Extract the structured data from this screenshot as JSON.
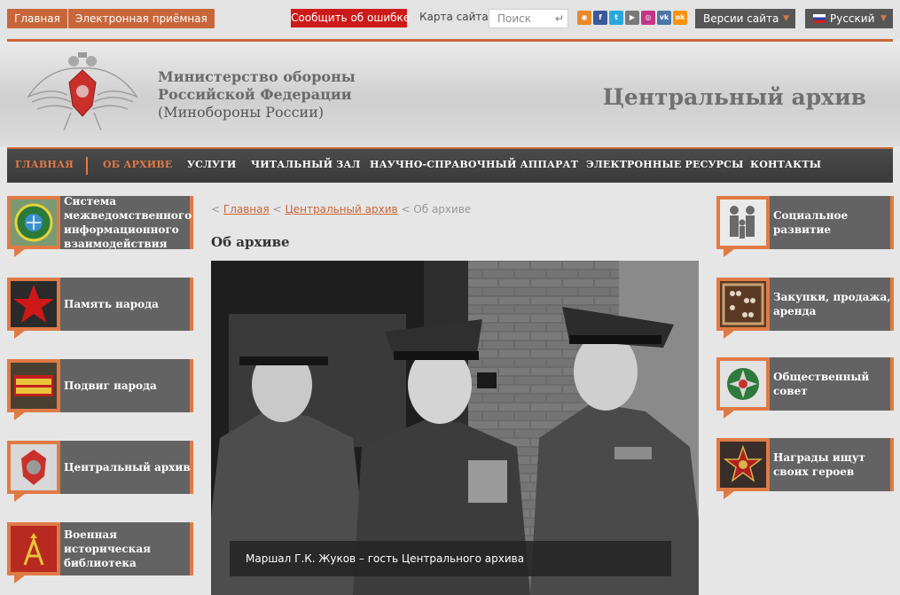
{
  "topbar": {
    "home_label": "Главная",
    "reception_label": "Электронная приёмная",
    "report_error_label": "Сообщить об ошибке",
    "sitemap_label": "Карта сайта",
    "search_placeholder": "Поиск",
    "social_icons": [
      "rss-icon",
      "facebook-icon",
      "twitter-icon",
      "youtube-icon",
      "instagram-icon",
      "vk-icon",
      "odnoklassniki-icon"
    ],
    "versions_label": "Версии сайта",
    "language_label": "Русский"
  },
  "header": {
    "ministry_line1": "Министерство обороны",
    "ministry_line2": "Российской Федерации",
    "ministry_line3": "(Минобороны России)",
    "site_title": "Центральный архив"
  },
  "nav": {
    "items": [
      {
        "label": "ГЛАВНАЯ",
        "active": true
      },
      {
        "label": "ОБ АРХИВЕ",
        "active": true
      },
      {
        "label": "УСЛУГИ"
      },
      {
        "label": "ЧИТАЛЬНЫЙ ЗАЛ"
      },
      {
        "label": "НАУЧНО-СПРАВОЧНЫЙ АППАРАТ"
      },
      {
        "label": "ЭЛЕКТРОННЫЕ РЕСУРСЫ"
      },
      {
        "label": "КОНТАКТЫ"
      }
    ]
  },
  "left_tiles": [
    {
      "label": "Система межведомственного информационного взаимодействия",
      "icon": "globe-emblem-icon"
    },
    {
      "label": "Память народа",
      "icon": "red-star-icon"
    },
    {
      "label": "Подвиг народа",
      "icon": "podvig-naroda-logo-icon"
    },
    {
      "label": "Центральный архив",
      "icon": "archive-emblem-icon"
    },
    {
      "label": "Военная историческая библиотека",
      "icon": "library-monogram-icon"
    }
  ],
  "right_tiles": [
    {
      "label": "Социальное развитие",
      "icon": "family-icon"
    },
    {
      "label": "Закупки, продажа, аренда",
      "icon": "abacus-icon"
    },
    {
      "label": "Общественный совет",
      "icon": "council-emblem-icon"
    },
    {
      "label": "Награды ищут своих героев",
      "icon": "order-medal-icon"
    }
  ],
  "breadcrumb": {
    "sep": "<",
    "home": "Главная",
    "archive": "Центральный архив",
    "current": "Об архиве"
  },
  "page": {
    "title": "Об архиве",
    "photo_caption": "Маршал Г.К. Жуков – гость Центрального архива"
  },
  "colors": {
    "accent": "#e07a45",
    "nav_bg": "#3f3f3f",
    "tile_bg": "#636363",
    "error_red": "#cc1a1a"
  }
}
